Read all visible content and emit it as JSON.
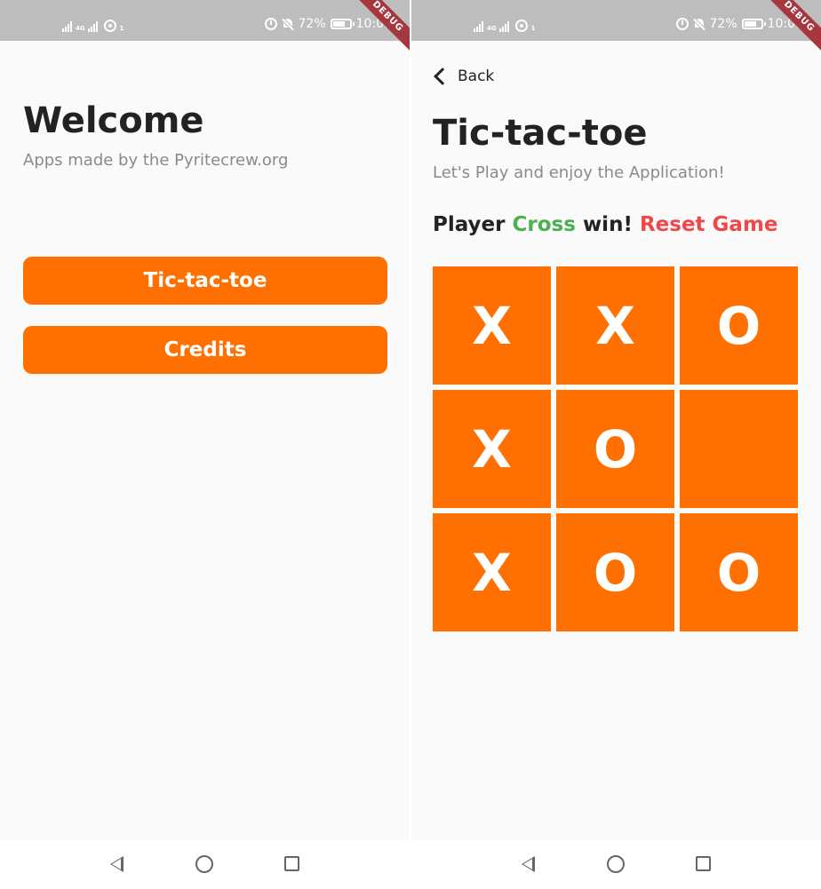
{
  "status_bar": {
    "network": "4G",
    "hotspot_badge": "1",
    "battery_percent": "72%",
    "battery_level": 0.72,
    "time": "10:01",
    "debug_banner": "DEBUG"
  },
  "home_screen": {
    "title": "Welcome",
    "subtitle": "Apps made by the Pyritecrew.org",
    "buttons": [
      {
        "label": "Tic-tac-toe"
      },
      {
        "label": "Credits"
      }
    ]
  },
  "game_screen": {
    "back_label": "Back",
    "title": "Tic-tac-toe",
    "subtitle": "Let's Play and enjoy the Application!",
    "status": {
      "prefix": "Player",
      "winner": "Cross",
      "suffix": "win!",
      "reset_label": "Reset Game"
    },
    "board": [
      "X",
      "X",
      "O",
      "X",
      "O",
      "",
      "X",
      "O",
      "O"
    ]
  },
  "colors": {
    "accent": "#ff7000",
    "winner": "#4caf50",
    "reset": "#f04848",
    "status_bar": "#bdbdbd"
  }
}
